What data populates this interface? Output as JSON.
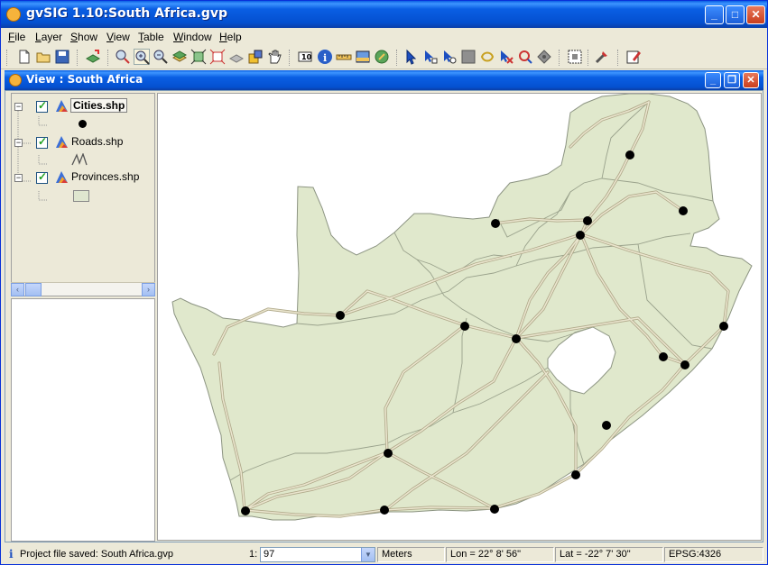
{
  "app": {
    "title": "gvSIG 1.10:South Africa.gvp",
    "window_controls": {
      "minimize": "_",
      "maximize": "□",
      "close": "✕"
    }
  },
  "menu": [
    {
      "label": "File",
      "mnemonic": "F"
    },
    {
      "label": "Layer",
      "mnemonic": "L"
    },
    {
      "label": "Show",
      "mnemonic": "S"
    },
    {
      "label": "View",
      "mnemonic": "V"
    },
    {
      "label": "Table",
      "mnemonic": "T"
    },
    {
      "label": "Window",
      "mnemonic": "W"
    },
    {
      "label": "Help",
      "mnemonic": "H"
    }
  ],
  "toolbar": {
    "icons": [
      "new-icon",
      "open-icon",
      "save-icon",
      "add-layer-icon",
      "zoom-in-icon",
      "zoom-in-selected-icon",
      "zoom-out-icon",
      "layers-zoom-icon",
      "full-extent-icon",
      "zoom-select-icon",
      "frame-icon",
      "zoom-selection-icon",
      "pan-icon",
      "label-icon",
      "info-icon",
      "measure-distance-icon",
      "measure-area-icon",
      "hyperlink-icon",
      "select-icon",
      "select-by-point-icon",
      "select-by-rect-icon",
      "select-by-polygon-icon",
      "select-by-shape-icon",
      "select-by-circle-icon",
      "select-by-buffer-icon",
      "invert-selection-icon",
      "grid-icon",
      "tools-icon",
      "edit-icon"
    ]
  },
  "view_window": {
    "title": "View : South Africa",
    "controls": {
      "minimize": "_",
      "restore": "❐",
      "close": "✕"
    }
  },
  "toc": {
    "layers": [
      {
        "name": "Cities.shp",
        "visible": true,
        "selected": true,
        "symbol": "point"
      },
      {
        "name": "Roads.shp",
        "visible": true,
        "selected": false,
        "symbol": "line"
      },
      {
        "name": "Provinces.shp",
        "visible": true,
        "selected": false,
        "symbol": "polygon"
      }
    ],
    "scroll_left": "‹",
    "scroll_right": "›"
  },
  "map": {
    "land_color": "#e0e8cc",
    "border_color": "#9aa28c",
    "road_color": "#d8d0b0",
    "city_color": "#000000"
  },
  "status": {
    "message": "Project file saved: South Africa.gvp",
    "scale_prefix": "1:",
    "scale_value": "97",
    "units": "Meters",
    "lon": "Lon = 22° 8' 56\"",
    "lat": "Lat = -22° 7' 30\"",
    "crs": "EPSG:4326"
  }
}
